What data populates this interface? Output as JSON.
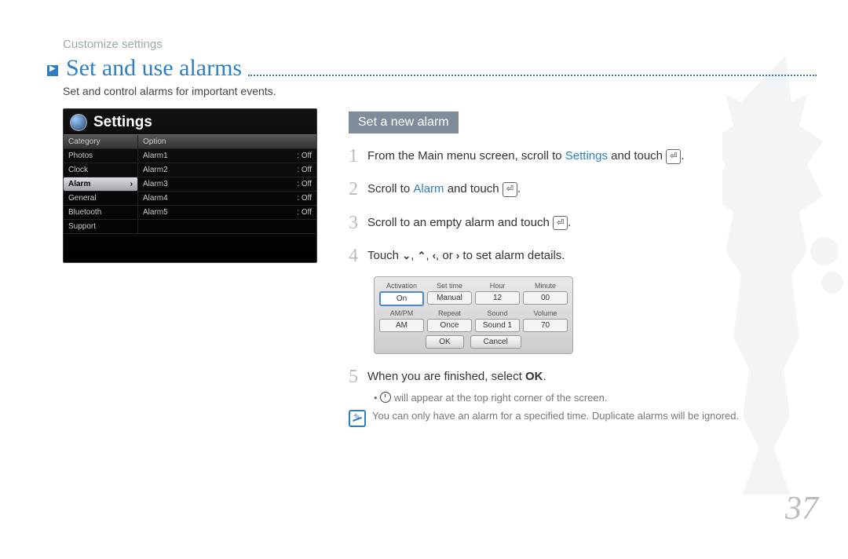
{
  "breadcrumb": "Customize settings",
  "title": "Set and use alarms",
  "subtitle": "Set and control alarms for important events.",
  "page_number": "37",
  "device": {
    "title": "Settings",
    "header_category": "Category",
    "header_option": "Option",
    "categories": [
      "Photos",
      "Clock",
      "Alarm",
      "General",
      "Bluetooth",
      "Support"
    ],
    "selected_category": "Alarm",
    "options": [
      {
        "name": "Alarm1",
        "value": ": Off"
      },
      {
        "name": "Alarm2",
        "value": ": Off"
      },
      {
        "name": "Alarm3",
        "value": ": Off"
      },
      {
        "name": "Alarm4",
        "value": ": Off"
      },
      {
        "name": "Alarm5",
        "value": ": Off"
      }
    ]
  },
  "section_heading": "Set a new alarm",
  "steps": {
    "s1_a": "From the Main menu screen, scroll to ",
    "s1_kw": "Settings",
    "s1_b": " and touch ",
    "s2_a": "Scroll to ",
    "s2_kw": "Alarm",
    "s2_b": " and touch ",
    "s3": "Scroll to an empty alarm and touch ",
    "s4_a": "Touch ",
    "s4_b": " to set alarm details.",
    "s5_a": "When you are finished, select ",
    "s5_kw": "OK",
    "s5_sub": " will appear at the top right corner of the screen.",
    "note": "You can only have an alarm for a specified time. Duplicate alarms will be ignored."
  },
  "alarm_panel": {
    "row1_labels": [
      "Activation",
      "Set time",
      "Hour",
      "Minute"
    ],
    "row1_values": [
      "On",
      "Manual",
      "12",
      "00"
    ],
    "row2_labels": [
      "AM/PM",
      "Repeat",
      "Sound",
      "Volume"
    ],
    "row2_values": [
      "AM",
      "Once",
      "Sound 1",
      "70"
    ],
    "ok": "OK",
    "cancel": "Cancel"
  },
  "glyphs": {
    "enter": "⏎",
    "down": "⌄",
    "up": "⌃",
    "left": "‹",
    "right": "›",
    "or": ", or ",
    "comma": ", "
  }
}
